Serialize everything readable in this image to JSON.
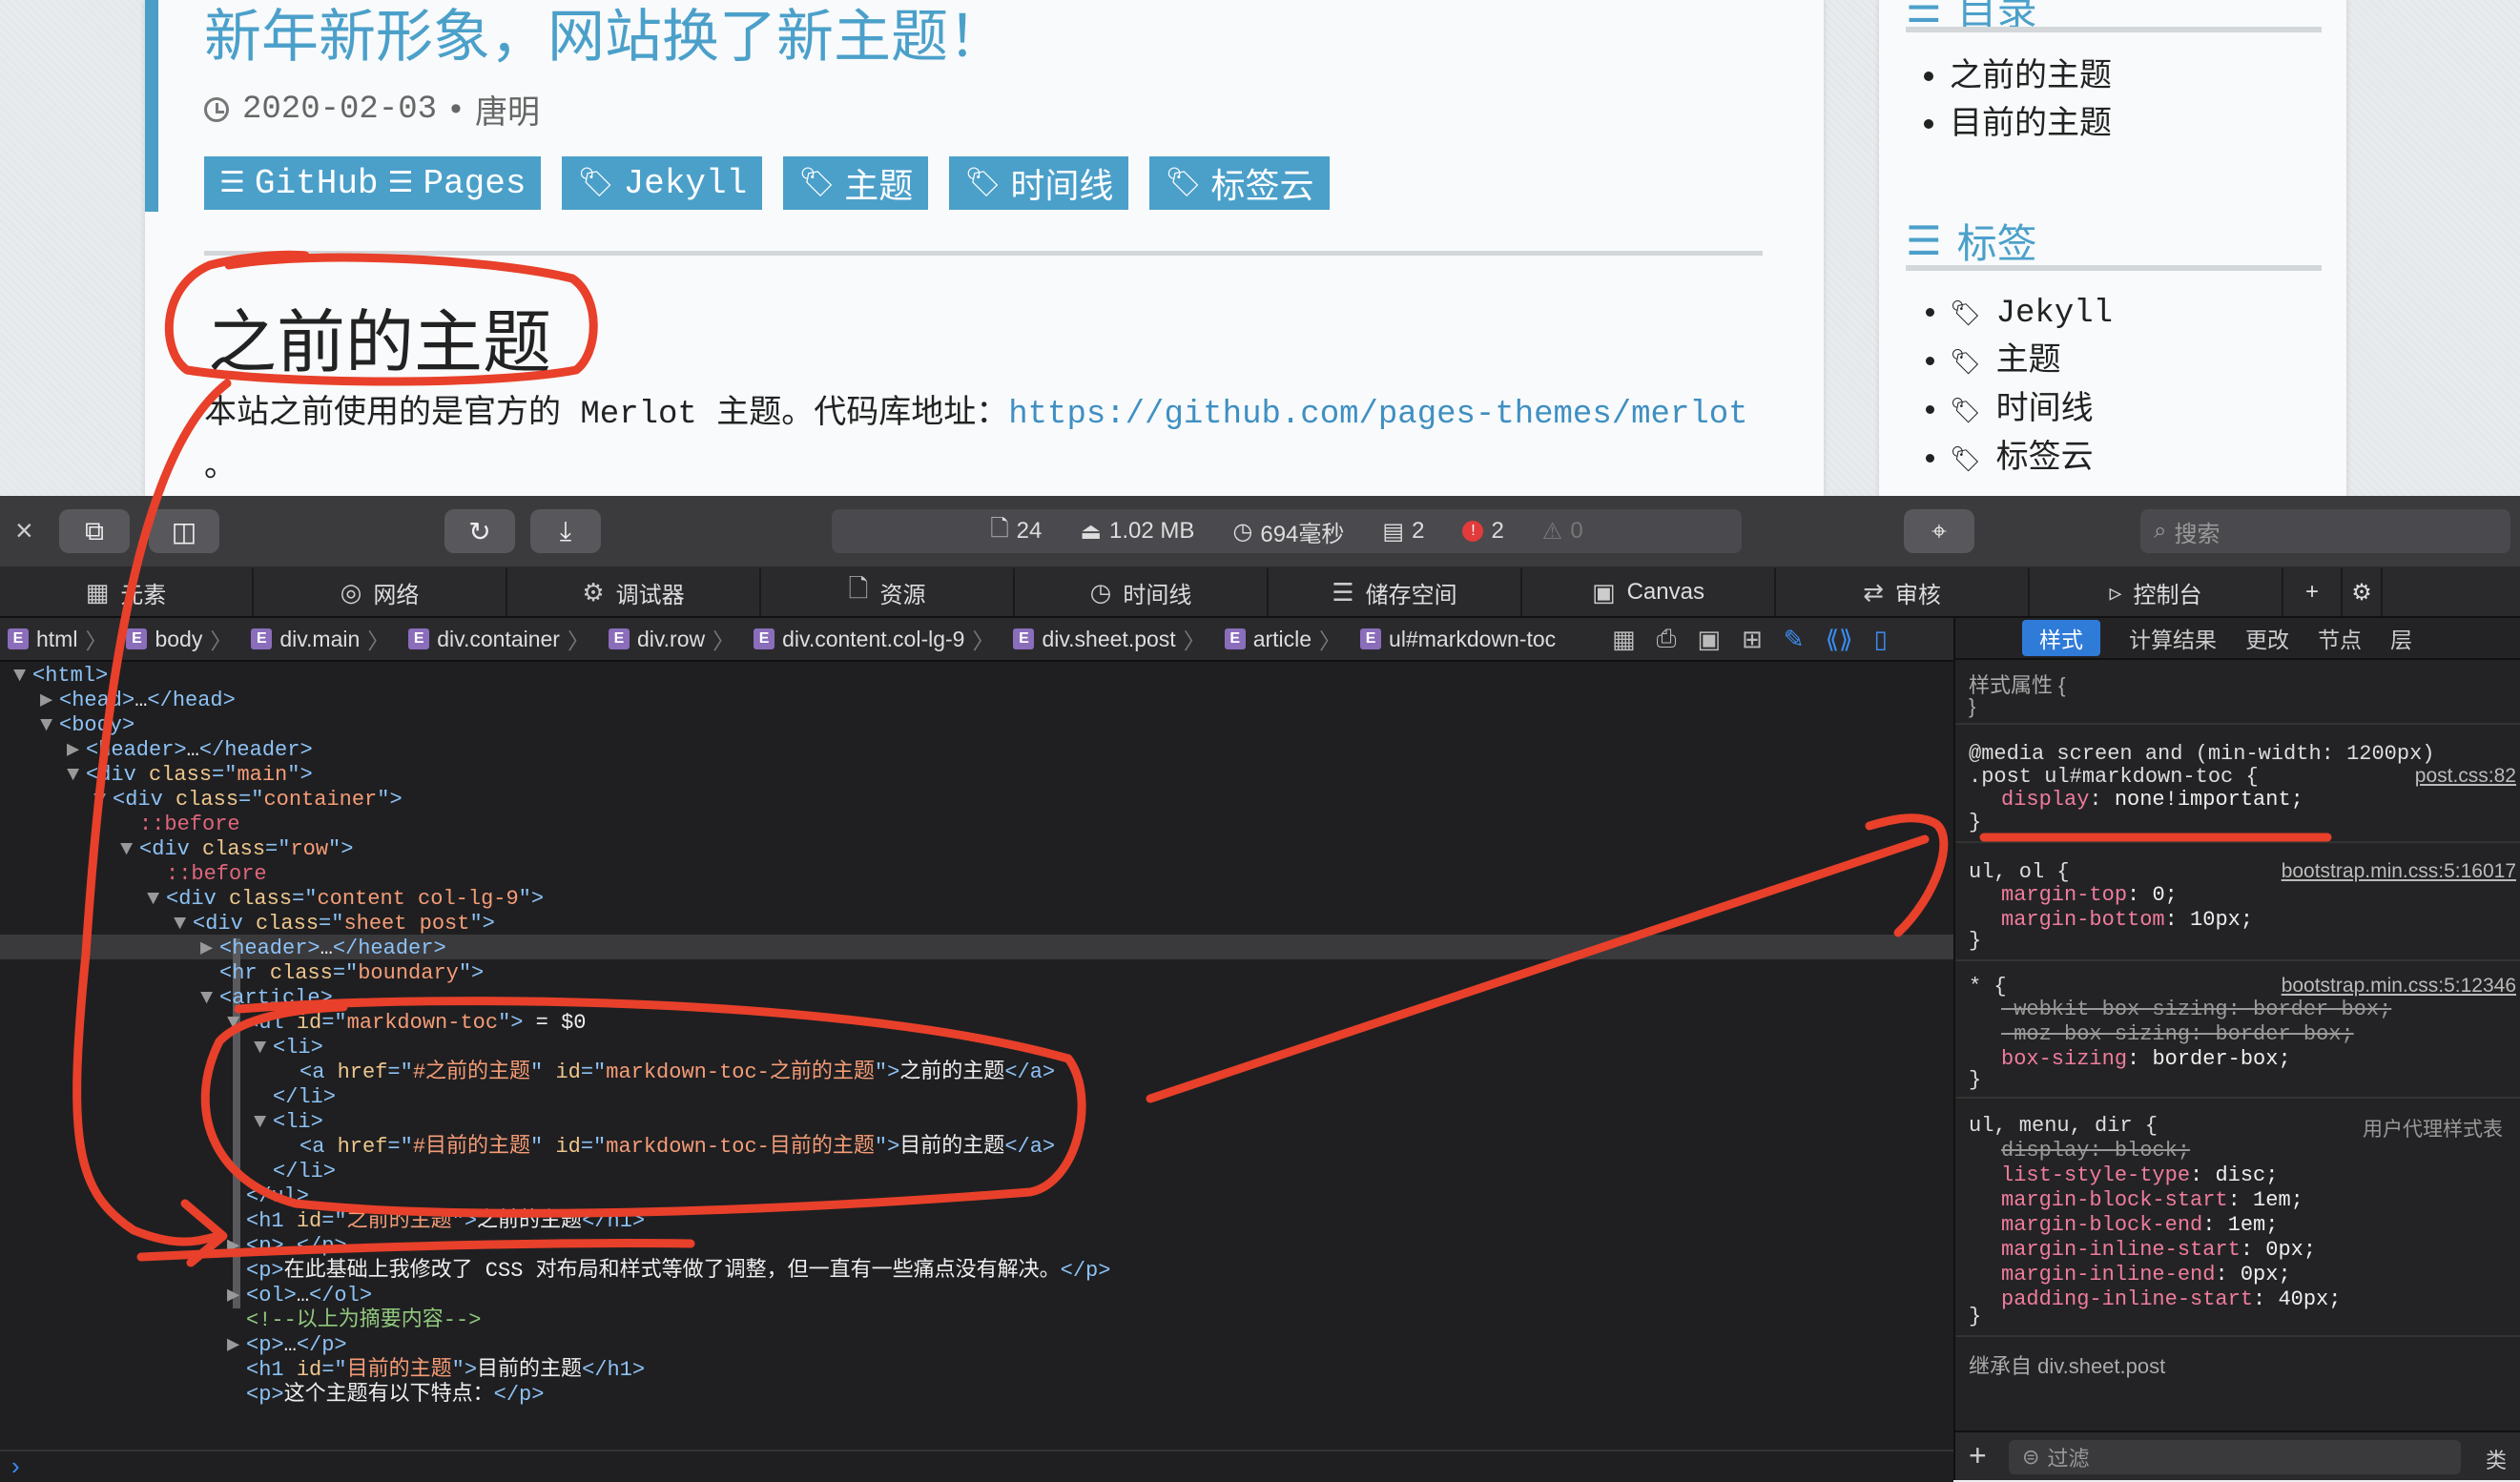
{
  "post": {
    "title": "新年新形象，网站换了新主题！",
    "date": "2020-02-03",
    "dot": "•",
    "author": "唐明",
    "tags": [
      {
        "icon": "☰",
        "label": "GitHub"
      },
      {
        "icon": "☰",
        "label": "Pages"
      },
      {
        "icon": "🏷",
        "label": "Jekyll"
      },
      {
        "icon": "🏷",
        "label": "主题"
      },
      {
        "icon": "🏷",
        "label": "时间线"
      },
      {
        "icon": "🏷",
        "label": "标签云"
      }
    ],
    "heading": "之前的主题",
    "intro_text": "本站之前使用的是官方的 Merlot 主题。代码库地址：",
    "intro_link": "https://github.com/pages-themes/merlot",
    "intro_tail": "。"
  },
  "sidebar": {
    "toc_title": "目录",
    "toc_items": [
      "之前的主题",
      "目前的主题"
    ],
    "tags_title": "标签",
    "tag_items": [
      "Jekyll",
      "主题",
      "时间线",
      "标签云"
    ]
  },
  "devtools": {
    "status": {
      "resources": "24",
      "size": "1.02 MB",
      "time": "694毫秒",
      "logs": "2",
      "errors": "2",
      "warnings": "0"
    },
    "search_placeholder": "搜索",
    "tabs": [
      "元素",
      "网络",
      "调试器",
      "资源",
      "时间线",
      "储存空间",
      "Canvas",
      "审核",
      "控制台"
    ],
    "breadcrumbs": [
      "html",
      "body",
      "div.main",
      "div.container",
      "div.row",
      "div.content.col-lg-9",
      "div.sheet.post",
      "article",
      "ul#markdown-toc"
    ],
    "style_tabs": [
      "样式",
      "计算结果",
      "更改",
      "节点",
      "层"
    ],
    "filter_placeholder": "过滤"
  },
  "dom_lines": [
    {
      "tri": "▼",
      "parts": [
        [
          "tg",
          "<html"
        ],
        [
          "tg",
          ">"
        ]
      ]
    },
    {
      "tri": "▶",
      "parts": [
        [
          "tg",
          "<head>"
        ],
        [
          "tx",
          "…"
        ],
        [
          "tg",
          "</head>"
        ]
      ]
    },
    {
      "tri": "▼",
      "parts": [
        [
          "tg",
          "<body>"
        ]
      ]
    },
    {
      "tri": "▶",
      "parts": [
        [
          "tg",
          "<header>"
        ],
        [
          "tx",
          "…"
        ],
        [
          "tg",
          "</header>"
        ]
      ]
    },
    {
      "tri": "▼",
      "parts": [
        [
          "tg",
          "<div "
        ],
        [
          "an",
          "class"
        ],
        [
          "tg",
          "=\""
        ],
        [
          "av",
          "main"
        ],
        [
          "tg",
          "\">"
        ]
      ]
    },
    {
      "tri": "▼",
      "parts": [
        [
          "tg",
          "<div "
        ],
        [
          "an",
          "class"
        ],
        [
          "tg",
          "=\""
        ],
        [
          "av",
          "container"
        ],
        [
          "tg",
          "\">"
        ]
      ]
    },
    {
      "tri": "",
      "parts": [
        [
          "ps",
          "::before"
        ]
      ]
    },
    {
      "tri": "▼",
      "parts": [
        [
          "tg",
          "<div "
        ],
        [
          "an",
          "class"
        ],
        [
          "tg",
          "=\""
        ],
        [
          "av",
          "row"
        ],
        [
          "tg",
          "\">"
        ]
      ]
    },
    {
      "tri": "",
      "parts": [
        [
          "ps",
          "::before"
        ]
      ]
    },
    {
      "tri": "▼",
      "parts": [
        [
          "tg",
          "<div "
        ],
        [
          "an",
          "class"
        ],
        [
          "tg",
          "=\""
        ],
        [
          "av",
          "content col-lg-9"
        ],
        [
          "tg",
          "\">"
        ]
      ]
    },
    {
      "tri": "▼",
      "parts": [
        [
          "tg",
          "<div "
        ],
        [
          "an",
          "class"
        ],
        [
          "tg",
          "=\""
        ],
        [
          "av",
          "sheet post"
        ],
        [
          "tg",
          "\">"
        ]
      ]
    },
    {
      "tri": "▶",
      "parts": [
        [
          "tg",
          "<header>"
        ],
        [
          "tx",
          "…"
        ],
        [
          "tg",
          "</header>"
        ]
      ]
    },
    {
      "tri": "",
      "parts": [
        [
          "tg",
          "<hr "
        ],
        [
          "an",
          "class"
        ],
        [
          "tg",
          "=\""
        ],
        [
          "av",
          "boundary"
        ],
        [
          "tg",
          "\">"
        ]
      ]
    },
    {
      "tri": "▼",
      "parts": [
        [
          "tg",
          "<article>"
        ]
      ]
    },
    {
      "tri": "▼",
      "parts": [
        [
          "tg",
          "<ul "
        ],
        [
          "an",
          "id"
        ],
        [
          "tg",
          "=\""
        ],
        [
          "av",
          "markdown-toc"
        ],
        [
          "tg",
          "\">"
        ],
        [
          "tx",
          " = $0"
        ]
      ]
    },
    {
      "tri": "▼",
      "parts": [
        [
          "tg",
          "<li>"
        ]
      ]
    },
    {
      "tri": "",
      "parts": [
        [
          "tg",
          "<a "
        ],
        [
          "an",
          "href"
        ],
        [
          "tg",
          "=\""
        ],
        [
          "av",
          "#之前的主题"
        ],
        [
          "tg",
          "\" "
        ],
        [
          "an",
          "id"
        ],
        [
          "tg",
          "=\""
        ],
        [
          "av",
          "markdown-toc-之前的主题"
        ],
        [
          "tg",
          "\">"
        ],
        [
          "tx",
          "之前的主题"
        ],
        [
          "tg",
          "</a>"
        ]
      ]
    },
    {
      "tri": "",
      "parts": [
        [
          "tg",
          "</li>"
        ]
      ]
    },
    {
      "tri": "▼",
      "parts": [
        [
          "tg",
          "<li>"
        ]
      ]
    },
    {
      "tri": "",
      "parts": [
        [
          "tg",
          "<a "
        ],
        [
          "an",
          "href"
        ],
        [
          "tg",
          "=\""
        ],
        [
          "av",
          "#目前的主题"
        ],
        [
          "tg",
          "\" "
        ],
        [
          "an",
          "id"
        ],
        [
          "tg",
          "=\""
        ],
        [
          "av",
          "markdown-toc-目前的主题"
        ],
        [
          "tg",
          "\">"
        ],
        [
          "tx",
          "目前的主题"
        ],
        [
          "tg",
          "</a>"
        ]
      ]
    },
    {
      "tri": "",
      "parts": [
        [
          "tg",
          "</li>"
        ]
      ]
    },
    {
      "tri": "",
      "parts": [
        [
          "tg",
          "</ul>"
        ]
      ]
    },
    {
      "tri": "",
      "parts": [
        [
          "tg",
          "<h1 "
        ],
        [
          "an",
          "id"
        ],
        [
          "tg",
          "=\""
        ],
        [
          "av",
          "之前的主题"
        ],
        [
          "tg",
          "\">"
        ],
        [
          "tx",
          "之前的主题"
        ],
        [
          "tg",
          "</h1>"
        ]
      ]
    },
    {
      "tri": "▶",
      "parts": [
        [
          "tg",
          "<p>"
        ],
        [
          "tx",
          "…"
        ],
        [
          "tg",
          "</p>"
        ]
      ]
    },
    {
      "tri": "",
      "parts": [
        [
          "tg",
          "<p>"
        ],
        [
          "tx",
          "在此基础上我修改了 CSS 对布局和样式等做了调整，但一直有一些痛点没有解决。"
        ],
        [
          "tg",
          "</p>"
        ]
      ]
    },
    {
      "tri": "▶",
      "parts": [
        [
          "tg",
          "<ol>"
        ],
        [
          "tx",
          "…"
        ],
        [
          "tg",
          "</ol>"
        ]
      ]
    },
    {
      "tri": "",
      "parts": [
        [
          "cm",
          "<!--以上为摘要内容-->"
        ]
      ]
    },
    {
      "tri": "▶",
      "parts": [
        [
          "tg",
          "<p>"
        ],
        [
          "tx",
          "…"
        ],
        [
          "tg",
          "</p>"
        ]
      ]
    },
    {
      "tri": "",
      "parts": [
        [
          "tg",
          "<h1 "
        ],
        [
          "an",
          "id"
        ],
        [
          "tg",
          "=\""
        ],
        [
          "av",
          "目前的主题"
        ],
        [
          "tg",
          "\">"
        ],
        [
          "tx",
          "目前的主题"
        ],
        [
          "tg",
          "</h1>"
        ]
      ]
    },
    {
      "tri": "",
      "parts": [
        [
          "tg",
          "<p>"
        ],
        [
          "tx",
          "这个主题有以下特点："
        ],
        [
          "tg",
          "</p>"
        ]
      ]
    }
  ],
  "styles": {
    "style_attr": "样式属性 {",
    "close": "}",
    "media": "@media screen and (min-width: 1200px)",
    "rule1_selector": ".post ul#markdown-toc {",
    "rule1_src": "post.css:82",
    "rule1_prop": "display",
    "rule1_val": "none!important;",
    "rule2_selector": "ul, ol {",
    "rule2_src": "bootstrap.min.css:5:16017",
    "rule2_props": [
      [
        "margin-top",
        "0;"
      ],
      [
        "margin-bottom",
        "10px;"
      ]
    ],
    "rule3_selector": "* {",
    "rule3_src": "bootstrap.min.css:5:12346",
    "rule3_props": [
      [
        "-webkit-box-sizing",
        "border-box;"
      ],
      [
        "-moz-box-sizing",
        "border-box;"
      ],
      [
        "box-sizing",
        "border-box;"
      ]
    ],
    "rule4_selector": "ul, menu, dir {",
    "rule4_src": "用户代理样式表",
    "rule4_props": [
      [
        "display",
        "block;"
      ],
      [
        "list-style-type",
        "disc;"
      ],
      [
        "margin-block-start",
        "1em;"
      ],
      [
        "margin-block-end",
        "1em;"
      ],
      [
        "margin-inline-start",
        "0px;"
      ],
      [
        "margin-inline-end",
        "0px;"
      ],
      [
        "padding-inline-start",
        "40px;"
      ]
    ],
    "inherited": "继承自 div.sheet.post"
  },
  "colors": {
    "accent": "#4ba0ca",
    "annotation": "#e8402a",
    "selected": "#2f7bd8"
  }
}
